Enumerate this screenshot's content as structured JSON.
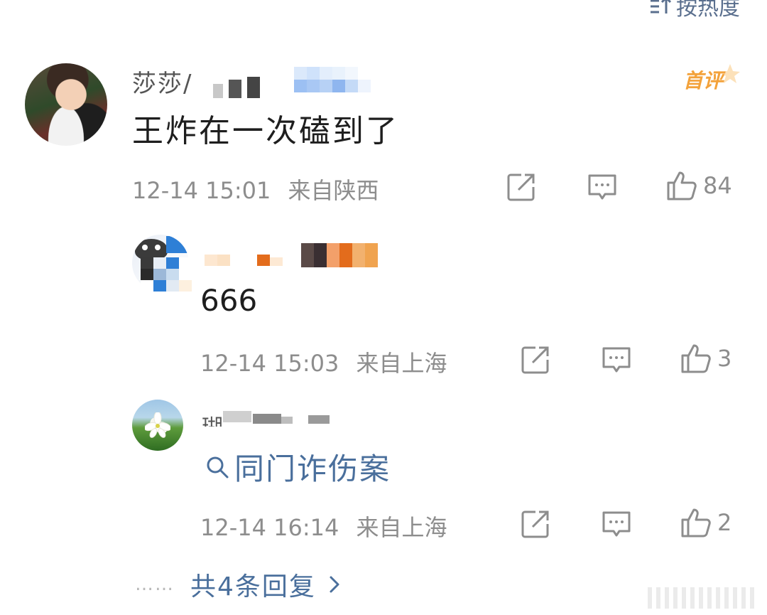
{
  "sort": {
    "label": "按热度",
    "icon": "sort-icon"
  },
  "comment": {
    "username": "莎莎/",
    "badge": "首评",
    "text": "王炸在一次磕到了",
    "time": "12-14 15:01",
    "location": "来自陕西",
    "likes": "84"
  },
  "replies": [
    {
      "username": "",
      "text": "666",
      "time": "12-14 15:03",
      "location": "来自上海",
      "likes": "3"
    },
    {
      "username": "瑚",
      "link_text": "同门诈伤案",
      "time": "12-14 16:14",
      "location": "来自上海",
      "likes": "2"
    }
  ],
  "more_replies": {
    "dots": "……",
    "label": "共4条回复"
  },
  "colors": {
    "link": "#4a6f9c",
    "meta": "#8d8d8d",
    "badge": "#f3a23b"
  }
}
